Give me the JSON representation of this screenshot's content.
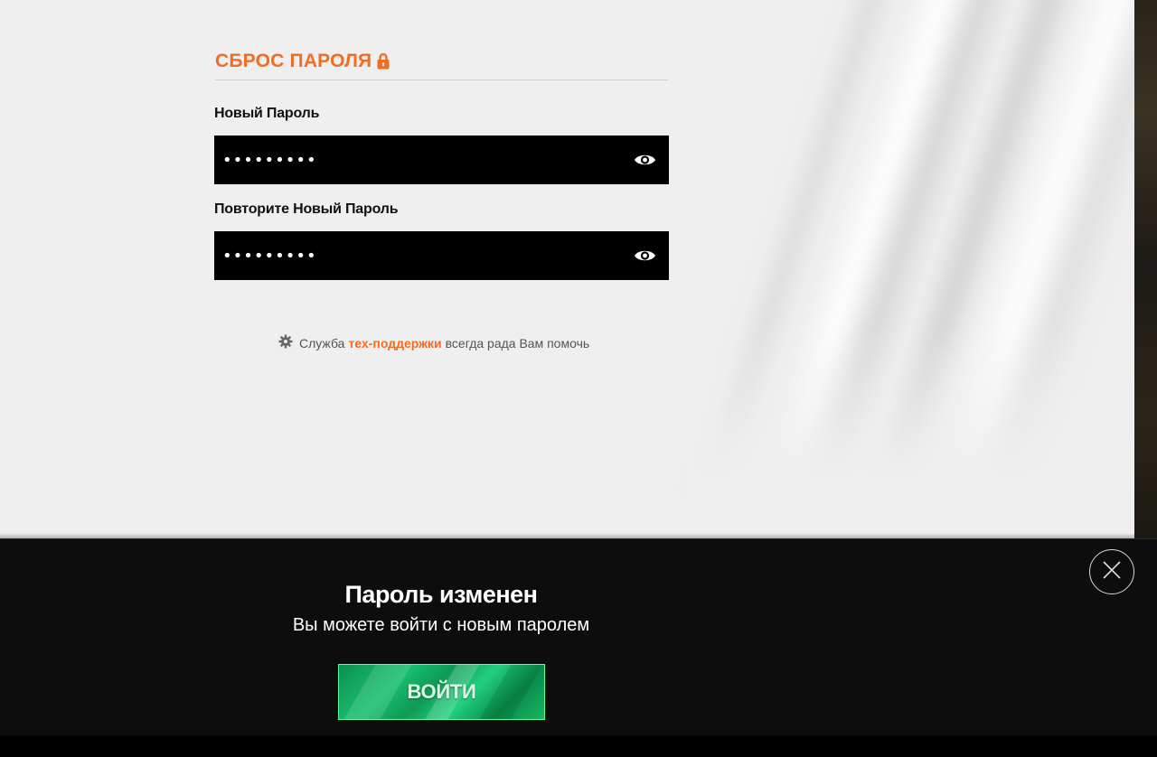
{
  "form": {
    "title": "СБРОС ПАРОЛЯ",
    "new_password_label": "Новый Пароль",
    "new_password_value": "•••••••••",
    "repeat_password_label": "Повторите Новый Пароль",
    "repeat_password_value": "•••••••••"
  },
  "support": {
    "prefix": "Служба",
    "link": "тех-поддержки",
    "suffix": "всегда рада Вам помочь"
  },
  "notification": {
    "title": "Пароль изменен",
    "subtitle": "Вы можете войти с новым паролем",
    "button_label": "ВОЙТИ"
  },
  "colors": {
    "accent": "#f26d21",
    "panel_bg": "#efefef",
    "button_green": "#19c06e"
  }
}
